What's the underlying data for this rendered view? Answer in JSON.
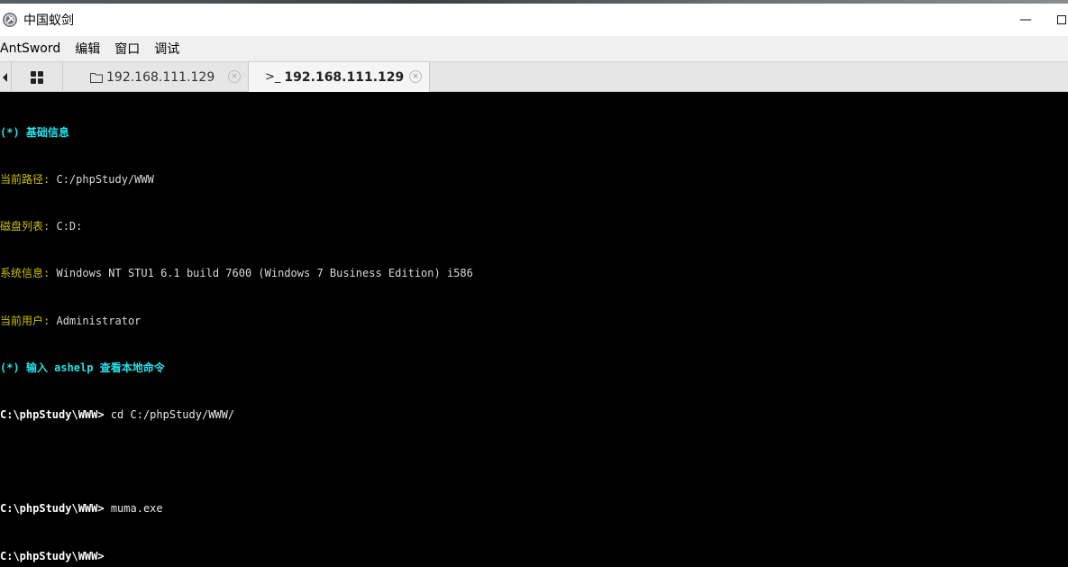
{
  "window": {
    "title": "中国蚁剑",
    "minimize_glyph": "—"
  },
  "menu": {
    "items": [
      "AntSword",
      "编辑",
      "窗口",
      "调试"
    ]
  },
  "tabs": [
    {
      "icon": "folder-icon",
      "label": "192.168.111.129",
      "active": false
    },
    {
      "icon": "terminal-icon",
      "icon_text": ">_",
      "label": "192.168.111.129",
      "active": true
    }
  ],
  "tab_close_glyph": "×",
  "terminal": {
    "info_header": "(*) 基础信息",
    "info": [
      {
        "label": "当前路径",
        "value": "C:/phpStudy/WWW"
      },
      {
        "label": "磁盘列表",
        "value": "C:D:"
      },
      {
        "label": "系统信息",
        "value": "Windows NT STU1 6.1 build 7600 (Windows 7 Business Edition) i586"
      },
      {
        "label": "当前用户",
        "value": "Administrator"
      }
    ],
    "help_line": "(*) 输入 ashelp 查看本地命令",
    "separator": ": ",
    "prompt": "C:\\phpStudy\\WWW>",
    "commands": [
      "cd C:/phpStudy/WWW/",
      "muma.exe"
    ]
  },
  "colors": {
    "terminal_bg": "#000000",
    "info_cyan": "#22e0e8",
    "label_olive": "#c8c000"
  }
}
